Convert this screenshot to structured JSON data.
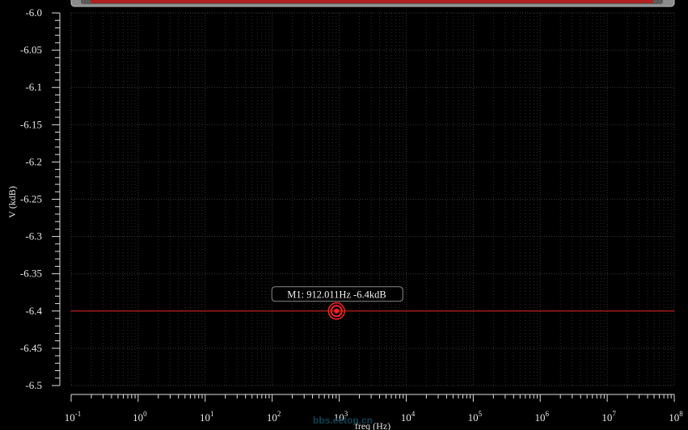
{
  "chart_data": {
    "type": "line",
    "xscale": "log",
    "xlim": [
      0.1,
      100000000
    ],
    "ylim": [
      -6.5,
      -6.0
    ],
    "xlabel": "freq (Hz)",
    "ylabel": "V (kdB)",
    "y_ticks": [
      "-6.0",
      "-6.05",
      "-6.1",
      "-6.15",
      "-6.2",
      "-6.25",
      "-6.3",
      "-6.35",
      "-6.4",
      "-6.45",
      "-6.5"
    ],
    "x_tick_bases": [
      "10",
      "10",
      "10",
      "10",
      "10",
      "10",
      "10",
      "10",
      "10",
      "10"
    ],
    "x_tick_exponents": [
      "-1",
      "0",
      "1",
      "2",
      "3",
      "4",
      "5",
      "6",
      "7",
      "8"
    ],
    "grid": true,
    "series": [
      {
        "color": "#cc1f1f",
        "x": [
          0.1,
          100000000
        ],
        "y": [
          -6.4,
          -6.4
        ]
      }
    ],
    "marker": {
      "label": "M1: 912.011Hz -6.4kdB",
      "x": 912.011,
      "y": -6.4,
      "color": "#ff2020"
    }
  },
  "colors": {
    "background": "#000000",
    "grid": "#3a3a3a",
    "axis": "#e0e0e0",
    "trace": "#cc1f1f"
  },
  "watermark": "bbs.eetop.cn"
}
